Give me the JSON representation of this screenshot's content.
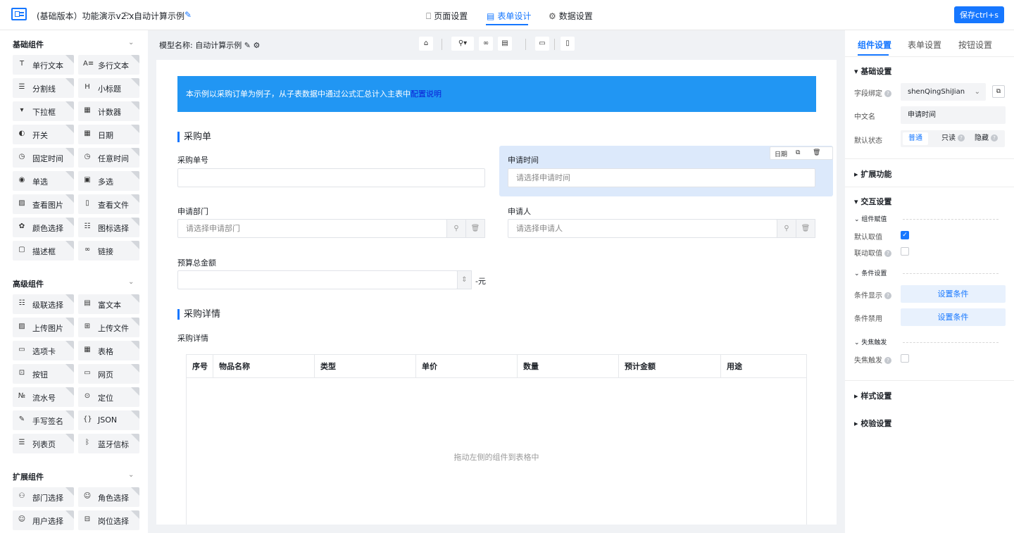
{
  "header": {
    "app_title": "(基础版本）功能演示v2.x",
    "separator": ">",
    "page_title": "自动计算示例",
    "tabs": [
      {
        "label": "页面设置",
        "icon": "bookmark-icon"
      },
      {
        "label": "表单设计",
        "icon": "document-icon",
        "active": true
      },
      {
        "label": "数据设置",
        "icon": "gear-icon"
      }
    ],
    "save_label": "保存ctrl+s"
  },
  "left_panel": {
    "groups": [
      {
        "title": "基础组件",
        "items": [
          "单行文本",
          "多行文本",
          "分割线",
          "小标题",
          "下拉框",
          "计数器",
          "开关",
          "日期",
          "固定时间",
          "任意时间",
          "单选",
          "多选",
          "查看图片",
          "查看文件",
          "颜色选择",
          "图标选择",
          "描述框",
          "链接"
        ]
      },
      {
        "title": "高级组件",
        "items": [
          "级联选择",
          "富文本",
          "上传图片",
          "上传文件",
          "选项卡",
          "表格",
          "按钮",
          "网页",
          "流水号",
          "定位",
          "手写签名",
          "JSON",
          "列表页",
          "蓝牙信标"
        ]
      },
      {
        "title": "扩展组件",
        "items": [
          "部门选择",
          "角色选择",
          "用户选择",
          "岗位选择"
        ]
      }
    ]
  },
  "center": {
    "model_label": "模型名称:",
    "model_name": "自动计算示例",
    "banner_text": "本示例以采购订单为例子，从子表数据中通过公式汇总计入主表中",
    "banner_link": "配置说明",
    "section1_title": "采购单",
    "fields": {
      "order_no_label": "采购单号",
      "apply_time_label": "申请时间",
      "apply_time_placeholder": "请选择申请时间",
      "dept_label": "申请部门",
      "dept_placeholder": "请选择申请部门",
      "applicant_label": "申请人",
      "applicant_placeholder": "请选择申请人",
      "budget_label": "预算总金额",
      "budget_unit": "-元"
    },
    "selected_tools": {
      "date_label": "日期"
    },
    "section2_title": "采购详情",
    "subtable_label": "采购详情",
    "table_headers": [
      "序号",
      "物品名称",
      "类型",
      "单价",
      "数量",
      "预计金额",
      "用途"
    ],
    "empty_hint": "拖动左侧的组件到表格中"
  },
  "right_panel": {
    "tabs": [
      "组件设置",
      "表单设置",
      "按钮设置"
    ],
    "basic_section": "基础设置",
    "field_bind_label": "字段绑定",
    "field_bind_value": "shenQingShiJian",
    "cn_name_label": "中文名",
    "cn_name_value": "申请时间",
    "default_state_label": "默认状态",
    "state_options": [
      "普通",
      "只读",
      "隐藏"
    ],
    "ext_section": "扩展功能",
    "interact_section": "交互设置",
    "assign_sub": "组件赋值",
    "default_value_label": "默认取值",
    "link_value_label": "联动取值",
    "condition_sub": "条件设置",
    "cond_show_label": "条件显示",
    "cond_disable_label": "条件禁用",
    "set_condition": "设置条件",
    "blur_sub": "失焦触发",
    "blur_label": "失焦触发",
    "style_section": "样式设置",
    "verify_section": "校验设置"
  }
}
